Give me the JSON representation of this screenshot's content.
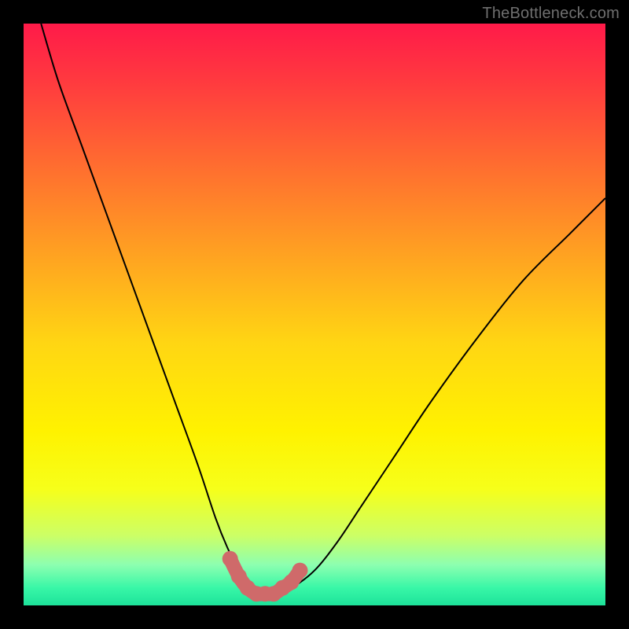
{
  "watermark": "TheBottleneck.com",
  "colors": {
    "frame": "#000000",
    "curve": "#000000",
    "marker_fill": "#cf6a6a",
    "marker_stroke": "#cf6a6a",
    "gradient_stops": [
      {
        "offset": 0.0,
        "color": "#ff1a49"
      },
      {
        "offset": 0.1,
        "color": "#ff3a3f"
      },
      {
        "offset": 0.25,
        "color": "#ff6f2f"
      },
      {
        "offset": 0.4,
        "color": "#ffa321"
      },
      {
        "offset": 0.55,
        "color": "#ffd613"
      },
      {
        "offset": 0.7,
        "color": "#fff200"
      },
      {
        "offset": 0.8,
        "color": "#f6ff1a"
      },
      {
        "offset": 0.88,
        "color": "#ccff66"
      },
      {
        "offset": 0.93,
        "color": "#8dffb0"
      },
      {
        "offset": 0.97,
        "color": "#38f7a7"
      },
      {
        "offset": 1.0,
        "color": "#1de29a"
      }
    ]
  },
  "chart_data": {
    "type": "line",
    "title": "",
    "xlabel": "",
    "ylabel": "",
    "xlim": [
      0,
      100
    ],
    "ylim": [
      0,
      100
    ],
    "series": [
      {
        "name": "bottleneck-curve",
        "x": [
          3,
          6,
          10,
          14,
          18,
          22,
          26,
          30,
          33,
          35,
          37,
          39,
          41,
          43,
          46,
          50,
          54,
          58,
          64,
          70,
          78,
          86,
          94,
          100
        ],
        "y": [
          100,
          90,
          79,
          68,
          57,
          46,
          35,
          24,
          15,
          10,
          6,
          3,
          2,
          2,
          3,
          6,
          11,
          17,
          26,
          35,
          46,
          56,
          64,
          70
        ]
      }
    ],
    "markers": {
      "name": "trough-highlight",
      "x": [
        35.5,
        37,
        38.5,
        40,
        41.5,
        43,
        44.5,
        46,
        47.5
      ],
      "y": [
        8,
        5,
        3,
        2,
        2,
        2,
        3,
        4,
        6
      ],
      "style": "rounded"
    }
  }
}
